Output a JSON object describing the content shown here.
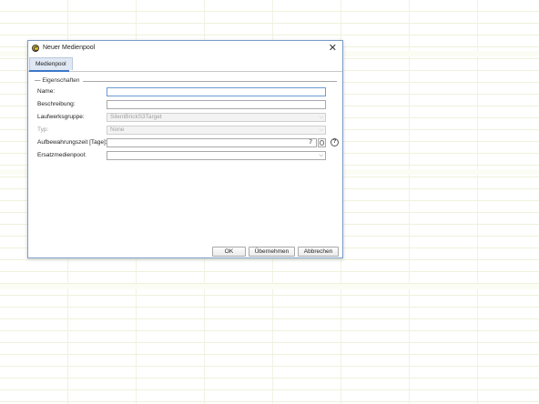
{
  "dialog": {
    "title": "Neuer Medienpool",
    "icon": "app-logo-icon",
    "close_glyph": "✕"
  },
  "tabs": [
    {
      "label": "Medienpool",
      "selected": true
    }
  ],
  "group": {
    "title": "Eigenschaften"
  },
  "fields": {
    "name": {
      "label": "Name:",
      "value": ""
    },
    "beschreibung": {
      "label": "Beschreibung:",
      "value": ""
    },
    "laufwerksgruppe": {
      "label": "Laufwerksgruppe:",
      "value": "SilentBrickS3Target",
      "disabled": true
    },
    "typ": {
      "label": "Typ:",
      "value": "None",
      "disabled": true
    },
    "aufbewahrungszeit": {
      "label": "Aufbewahrungszeit [Tage]:",
      "value": "7"
    },
    "ersatzmedienpool": {
      "label": "Ersatzmedienpool:",
      "value": ""
    }
  },
  "help_glyph": "?",
  "buttons": {
    "ok": "OK",
    "apply": "Übernehmen",
    "cancel": "Abbrechen"
  },
  "colors": {
    "focus_border": "#6b9bd2",
    "tab_accent": "#3c78c8",
    "window_border": "#7a9cc7"
  }
}
